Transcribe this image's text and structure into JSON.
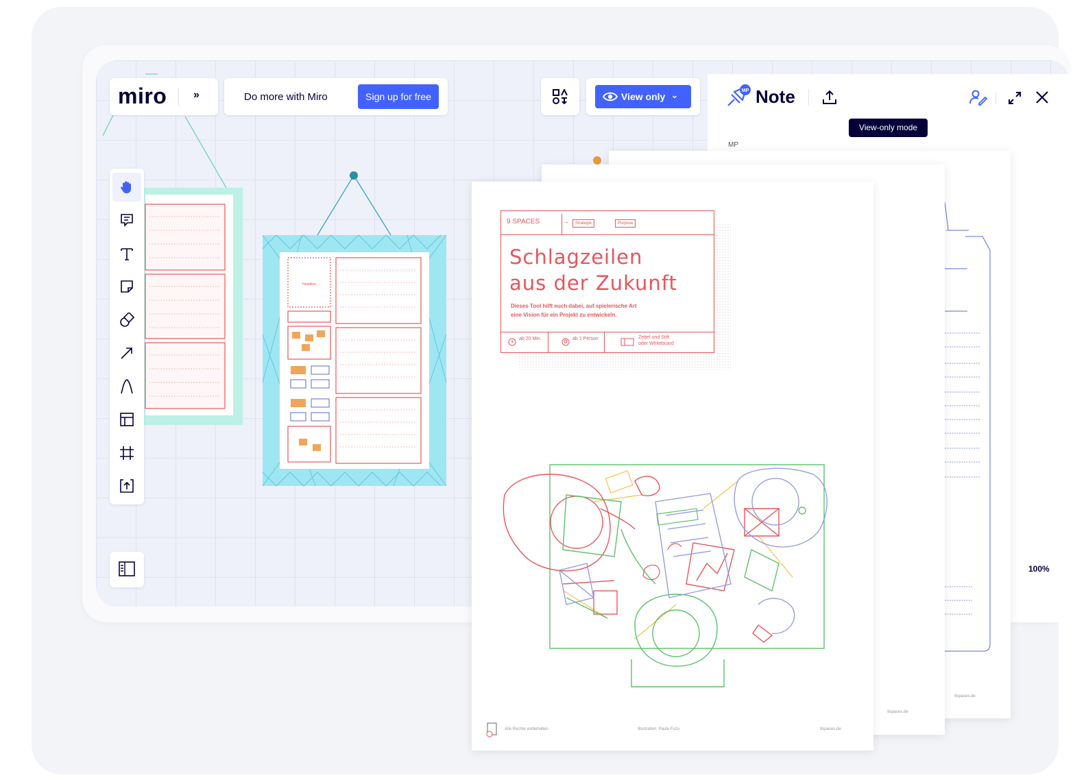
{
  "header": {
    "logo": "miro",
    "promo_text": "Do more with Miro",
    "signup_label": "Sign up for free",
    "view_label": "View only"
  },
  "note_panel": {
    "title": "Note",
    "avatar_initials": "MP",
    "tooltip": "View-only mode",
    "author_initials": "MP",
    "zoom": "100%"
  },
  "toolbar": {
    "tools": [
      "hand-icon",
      "comment-icon",
      "text-icon",
      "sticky-note-icon",
      "shapes-icon",
      "arrow-icon",
      "pen-icon",
      "templates-icon",
      "frame-icon",
      "upload-icon"
    ]
  },
  "document": {
    "brand": "9 SPACES",
    "tags": [
      "Strategie",
      "Purpose"
    ],
    "title_line1": "Schlagzeilen",
    "title_line2": "aus der Zukunft",
    "description_line1": "Dieses Tool hilft euch dabei, auf spielerische Art",
    "description_line2": "eine Vision für ein Projekt zu entwickeln.",
    "meta_time": "ab 20 Min.",
    "meta_people": "ab 1 Person",
    "meta_material_line1": "Zettel und Stift",
    "meta_material_line2": "oder Whiteboard",
    "footer_rights": "Alle Rechte vorbehalten",
    "footer_illustration": "Illustration: Paula Fuzu",
    "footer_site": "9spaces.de",
    "footer_site_2": "9spaces.de",
    "footer_site_3": "9spaces.de"
  },
  "board": {
    "frame_label": "Headline",
    "accent": "#4262ff",
    "pink": "#e8555b"
  }
}
